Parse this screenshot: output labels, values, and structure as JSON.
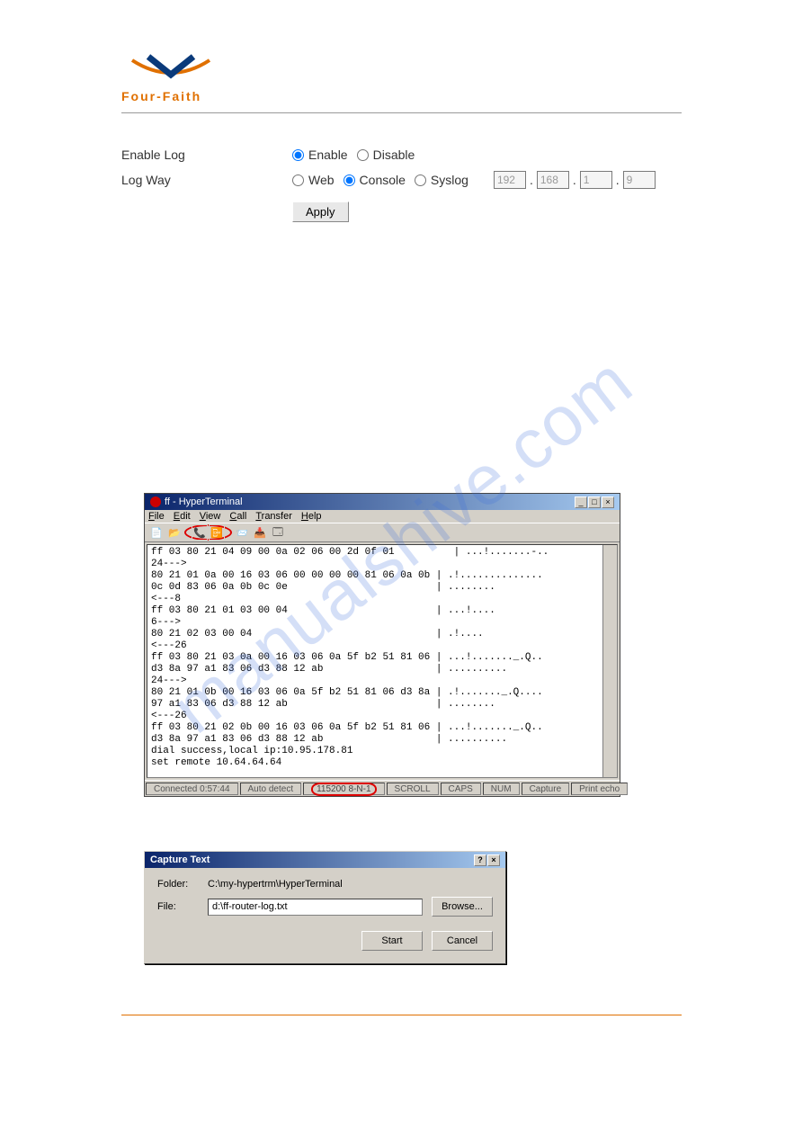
{
  "logo": {
    "brand": "Four-Faith"
  },
  "form": {
    "enable_log_label": "Enable Log",
    "log_way_label": "Log Way",
    "enable_option": "Enable",
    "disable_option": "Disable",
    "web_option": "Web",
    "console_option": "Console",
    "syslog_option": "Syslog",
    "ip": [
      "192",
      "168",
      "1",
      "9"
    ],
    "apply_label": "Apply"
  },
  "hyperterminal": {
    "title": "ff - HyperTerminal",
    "menu": [
      "File",
      "Edit",
      "View",
      "Call",
      "Transfer",
      "Help"
    ],
    "toolbar_icons": [
      "new-file-icon",
      "open-file-icon",
      "connect-icon",
      "disconnect-icon",
      "send-icon",
      "receive-icon",
      "properties-icon"
    ],
    "content": "ff 03 80 21 04 09 00 0a 02 06 00 2d 0f 01          | ...!.......-.. \n24--->\n80 21 01 0a 00 16 03 06 00 00 00 00 81 06 0a 0b | .!..............\n0c 0d 83 06 0a 0b 0c 0e                         | ........\n<---8\nff 03 80 21 01 03 00 04                         | ...!....\n6--->\n80 21 02 03 00 04                               | .!....\n<---26\nff 03 80 21 03 0a 00 16 03 06 0a 5f b2 51 81 06 | ...!......._.Q..\nd3 8a 97 a1 83 06 d3 88 12 ab                   | ..........\n24--->\n80 21 01 0b 00 16 03 06 0a 5f b2 51 81 06 d3 8a | .!......._.Q....\n97 a1 83 06 d3 88 12 ab                         | ........\n<---26\nff 03 80 21 02 0b 00 16 03 06 0a 5f b2 51 81 06 | ...!......._.Q..\nd3 8a 97 a1 83 06 d3 88 12 ab                   | ..........\ndial success,local ip:10.95.178.81\nset remote 10.64.64.64",
    "status": {
      "connected": "Connected 0:57:44",
      "detect": "Auto detect",
      "baud": "115200 8-N-1",
      "scroll": "SCROLL",
      "caps": "CAPS",
      "num": "NUM",
      "capture": "Capture",
      "print": "Print echo"
    }
  },
  "capture_dialog": {
    "title": "Capture Text",
    "folder_label": "Folder:",
    "folder_value": "C:\\my-hypertrm\\HyperTerminal",
    "file_label": "File:",
    "file_value": "d:\\ff-router-log.txt",
    "browse_label": "Browse...",
    "start_label": "Start",
    "cancel_label": "Cancel"
  },
  "watermark": "manualshive.com"
}
